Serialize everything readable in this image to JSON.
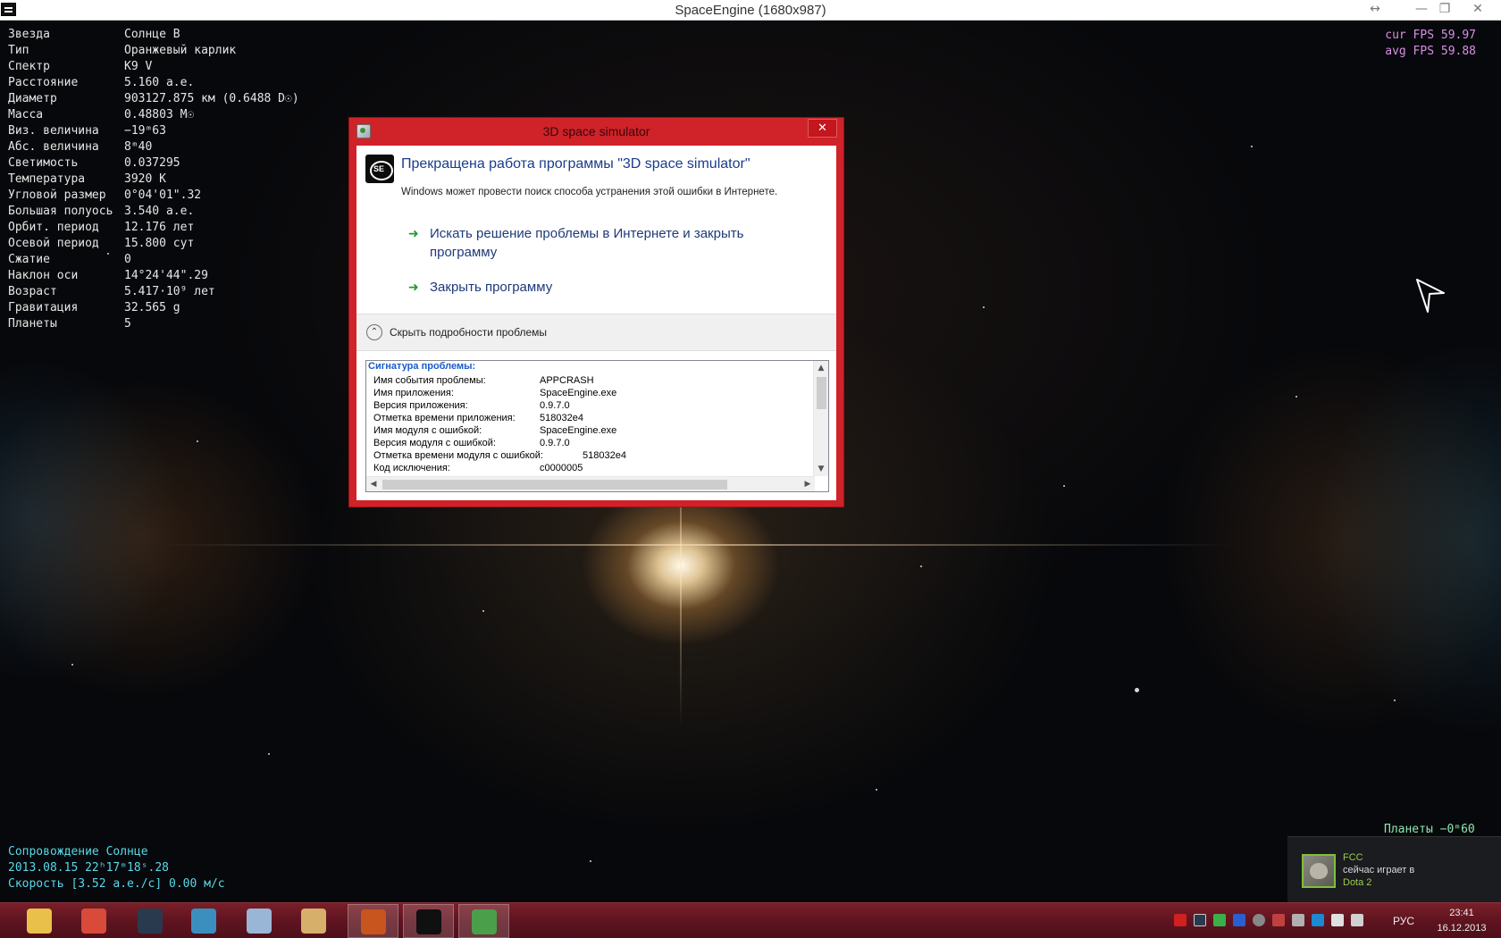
{
  "window": {
    "title": "SpaceEngine (1680x987)",
    "buttons": {
      "resize": "↔",
      "minimize": "—",
      "maximize": "❐",
      "close": "✕"
    }
  },
  "star_info": [
    {
      "label": "Звезда",
      "value": "Солнце B"
    },
    {
      "label": "Тип",
      "value": "Оранжевый карлик"
    },
    {
      "label": "Спектр",
      "value": "K9 V"
    },
    {
      "label": "Расстояние",
      "value": "5.160 а.е."
    },
    {
      "label": "Диаметр",
      "value": "903127.875 км (0.6488 D☉)"
    },
    {
      "label": "Масса",
      "value": "0.48803 M☉"
    },
    {
      "label": "Виз. величина",
      "value": "−19ᵐ63"
    },
    {
      "label": "Абс. величина",
      "value": "8ᵐ40"
    },
    {
      "label": "Светимость",
      "value": "0.037295"
    },
    {
      "label": "Температура",
      "value": "3920 K"
    },
    {
      "label": "Угловой размер",
      "value": "0°04'01\".32"
    },
    {
      "label": "Большая полуось",
      "value": "3.540 а.е."
    },
    {
      "label": "Орбит. период",
      "value": "12.176 лет"
    },
    {
      "label": "Осевой период",
      "value": "15.800 сут"
    },
    {
      "label": "Сжатие",
      "value": "0"
    },
    {
      "label": "Наклон оси",
      "value": "14°24'44\".29"
    },
    {
      "label": "Возраст",
      "value": "5.417·10⁹ лет"
    },
    {
      "label": "Гравитация",
      "value": "32.565 g"
    },
    {
      "label": "Планеты",
      "value": "5"
    }
  ],
  "fps": {
    "cur": "cur FPS 59.97",
    "avg": "avg FPS 59.88"
  },
  "planets_magnitude": "Планеты  −0ᵐ60",
  "bottom_info": {
    "tracking": "Сопровождение Солнце",
    "datetime": "2013.08.15  22ʰ17ᵐ18ˢ.28",
    "speed": "Скорость [3.52 а.е./с] 0.00 м/с"
  },
  "notification": {
    "name": "FCC",
    "text": "сейчас играет в",
    "game": "Dota 2",
    "accent": "#9acb4e"
  },
  "dialog": {
    "title": "3D space simulator",
    "close_glyph": "✕",
    "app_icon_text": "SE",
    "heading": "Прекращена работа программы \"3D space simulator\"",
    "subtext": "Windows может провести поиск способа устранения этой ошибки в Интернете.",
    "option_arrow": "➜",
    "option_search": "Искать решение проблемы в Интернете и закрыть программу",
    "option_close": "Закрыть программу",
    "details_chevron": "⌃",
    "details_label": "Скрыть подробности проблемы",
    "signature_heading": "Сигнатура проблемы:",
    "signature": [
      {
        "key": "Имя события проблемы:",
        "value": "APPCRASH"
      },
      {
        "key": "Имя приложения:",
        "value": "SpaceEngine.exe"
      },
      {
        "key": "Версия приложения:",
        "value": "0.9.7.0"
      },
      {
        "key": "Отметка времени приложения:",
        "value": "518032e4"
      },
      {
        "key": "Имя модуля с ошибкой:",
        "value": "SpaceEngine.exe"
      },
      {
        "key": "Версия модуля с ошибкой:",
        "value": "0.9.7.0"
      },
      {
        "key": "Отметка времени модуля с ошибкой:",
        "value": "518032e4"
      },
      {
        "key": "Код исключения:",
        "value": "c0000005"
      }
    ],
    "scroll_glyphs": {
      "up": "▲",
      "down": "▼",
      "left": "◀",
      "right": "▶"
    },
    "accent_color": "#cf2229"
  },
  "taskbar": {
    "apps": [
      {
        "name": "file-explorer-icon",
        "color": "#e8c04a"
      },
      {
        "name": "chrome-icon",
        "color": "#d84a3a"
      },
      {
        "name": "steam-icon",
        "color": "#2a3a4e"
      },
      {
        "name": "downloader-icon",
        "color": "#3a8fbf"
      },
      {
        "name": "calculator-icon",
        "color": "#9ab6d6"
      },
      {
        "name": "paint-icon",
        "color": "#d6b06a"
      },
      {
        "name": "game-app-icon",
        "color": "#c8541e"
      },
      {
        "name": "spaceengine-icon",
        "color": "#101010"
      },
      {
        "name": "error-reporting-icon",
        "color": "#4a9f4a"
      }
    ],
    "language": "РУС",
    "time": "23:41",
    "date": "16.12.2013",
    "color": "#5f1420"
  }
}
